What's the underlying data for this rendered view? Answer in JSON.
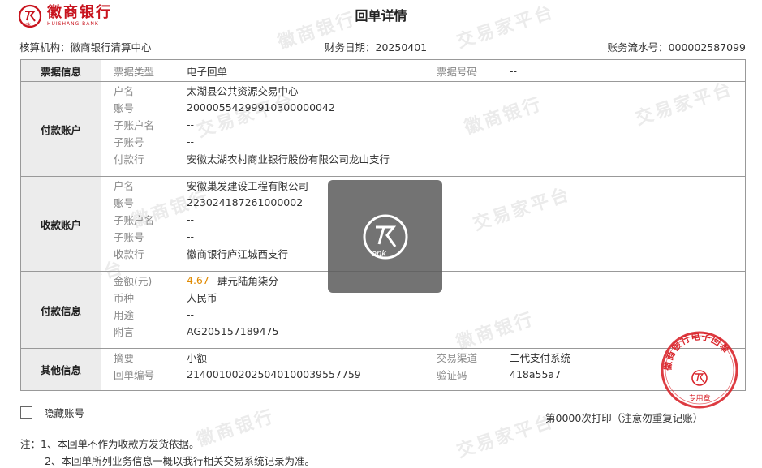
{
  "header": {
    "bank_name": "徽商银行",
    "bank_name_en": "HUISHANG BANK",
    "title": "回单详情",
    "org_label": "核算机构：",
    "org_value": "徽商银行清算中心",
    "date_label": "财务日期：",
    "date_value": "20250401",
    "serial_label": "账务流水号：",
    "serial_value": "000002587099"
  },
  "ticket": {
    "section": "票据信息",
    "type_label": "票据类型",
    "type_value": "电子回单",
    "no_label": "票据号码",
    "no_value": "--"
  },
  "payer": {
    "section": "付款账户",
    "rows": [
      {
        "label": "户名",
        "value": "太湖县公共资源交易中心"
      },
      {
        "label": "账号",
        "value": "20000554299910300000042"
      },
      {
        "label": "子账户名",
        "value": "--"
      },
      {
        "label": "子账号",
        "value": "--"
      },
      {
        "label": "付款行",
        "value": "安徽太湖农村商业银行股份有限公司龙山支行"
      }
    ]
  },
  "payee": {
    "section": "收款账户",
    "rows": [
      {
        "label": "户名",
        "value": "安徽巢发建设工程有限公司"
      },
      {
        "label": "账号",
        "value": "223024187261000002"
      },
      {
        "label": "子账户名",
        "value": "--"
      },
      {
        "label": "子账号",
        "value": "--"
      },
      {
        "label": "收款行",
        "value": "徽商银行庐江城西支行"
      }
    ]
  },
  "payment": {
    "section": "付款信息",
    "amount_label": "金额(元)",
    "amount_num": "4.67",
    "amount_cn": "肆元陆角柒分",
    "currency_label": "币种",
    "currency_value": "人民币",
    "purpose_label": "用途",
    "purpose_value": "--",
    "memo_label": "附言",
    "memo_value": "AG205157189475"
  },
  "other": {
    "section": "其他信息",
    "summary_label": "摘要",
    "summary_value": "小额",
    "receipt_no_label": "回单编号",
    "receipt_no_value": "21400100202504010003955775​9",
    "channel_label": "交易渠道",
    "channel_value": "二代支付系统",
    "verify_label": "验证码",
    "verify_value": "418a55a7"
  },
  "footer": {
    "hide_account_label": "隐藏账号",
    "print_text": "第0000次打印（注意勿重复记账）",
    "note1": "注：1、本回单不作为收款方发货依据。",
    "note2": "2、本回单所列业务信息一概以我行相关交易系统记录为准。"
  },
  "stamp": {
    "text": "徽商银行电子回单",
    "sub": "专用章",
    "color": "#d9262c"
  },
  "watermark": {
    "text": "徽商银行",
    "text2": "交易家平台"
  },
  "colors": {
    "brand_red": "#c8141e",
    "amount": "#e08a00",
    "section_bg": "#ececec"
  }
}
